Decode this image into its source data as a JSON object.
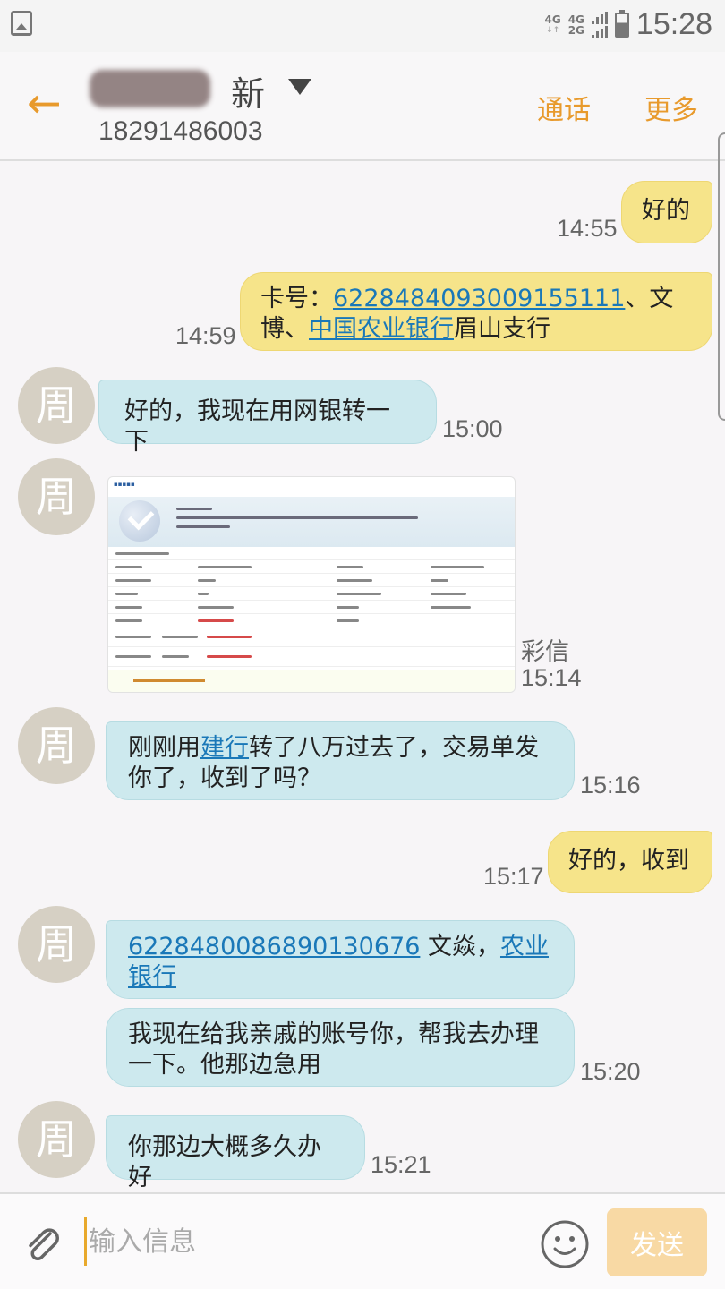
{
  "status_bar": {
    "network_1": "4G",
    "network_2_top": "4G",
    "network_2_bottom": "2G",
    "time": "15:28",
    "gallery_icon": "gallery-notification-icon",
    "battery_icon": "battery-charging-icon"
  },
  "header": {
    "back_icon": "←",
    "contact_name_visible": "新",
    "contact_number": "18291486003",
    "call_label": "通话",
    "more_label": "更多"
  },
  "contact_avatar_char": "周",
  "messages": [
    {
      "direction": "outgoing",
      "time": "14:55",
      "text": "好的"
    },
    {
      "direction": "outgoing",
      "time": "14:59",
      "prefix": "卡号：",
      "link1": "6228484093009155111",
      "mid": "、文博、",
      "link2": "中国农业银行",
      "suffix": "眉山支行"
    },
    {
      "direction": "incoming",
      "time": "15:00",
      "text": "好的，我现在用网银转一下"
    },
    {
      "direction": "incoming",
      "time": "15:14",
      "type_label": "彩信",
      "attachment": "bank-transfer-receipt-image"
    },
    {
      "direction": "incoming",
      "time": "15:16",
      "prefix": "刚刚用",
      "link1": "建行",
      "suffix": "转了八万过去了，交易单发你了，收到了吗？"
    },
    {
      "direction": "outgoing",
      "time": "15:17",
      "text": "好的，收到"
    },
    {
      "direction": "incoming",
      "time": "",
      "link1": "6228480086890130676",
      "mid": " 文焱，",
      "link2": "农业银行"
    },
    {
      "direction": "incoming",
      "time": "15:20",
      "text": "我现在给我亲戚的账号你，帮我去办理一下。他那边急用"
    },
    {
      "direction": "incoming",
      "time": "15:21",
      "text": "你那边大概多久办好"
    }
  ],
  "input_bar": {
    "placeholder": "输入信息",
    "value": "",
    "send_label": "发送"
  },
  "colors": {
    "accent": "#e89a2c",
    "outgoing_bubble": "#f6e48a",
    "incoming_bubble": "#cde9ee",
    "link": "#1a78b8",
    "send_disabled": "#f8d9a4"
  }
}
